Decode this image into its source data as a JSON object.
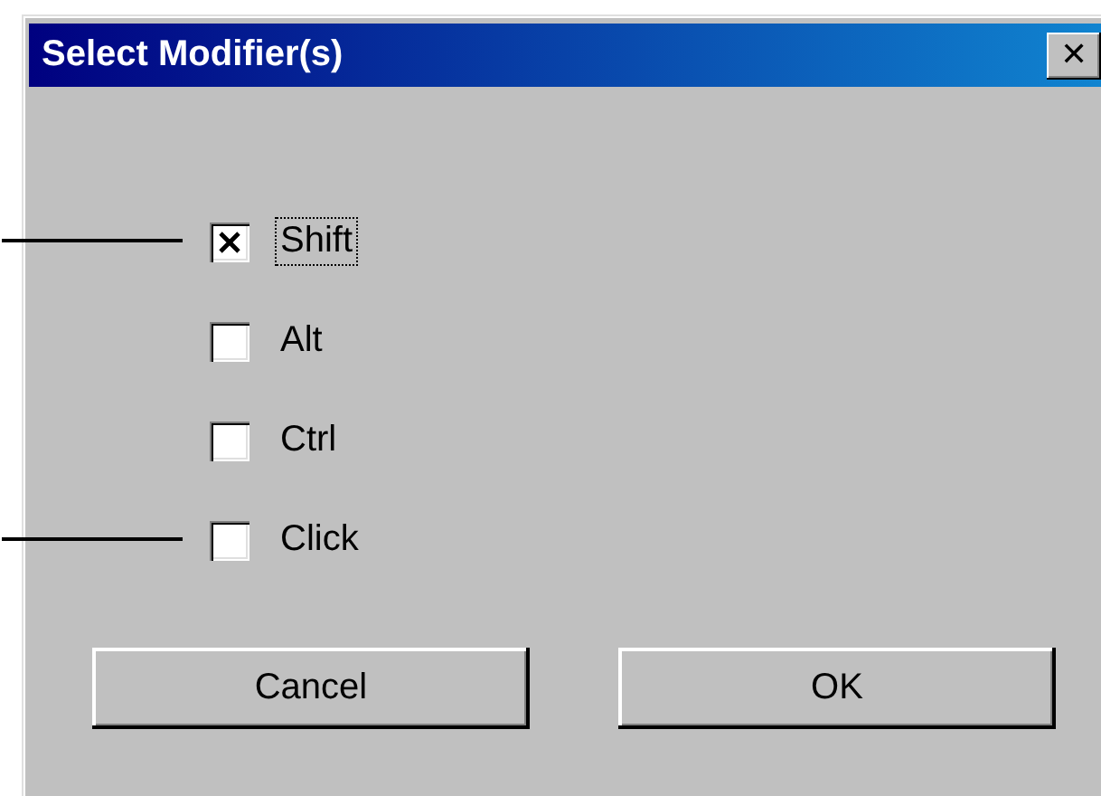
{
  "window": {
    "title": "Select Modifier(s)",
    "close": "✕"
  },
  "checkboxes": [
    {
      "label": "Shift",
      "checked": true,
      "focused": true,
      "callout": true
    },
    {
      "label": "Alt",
      "checked": false,
      "focused": false,
      "callout": false
    },
    {
      "label": "Ctrl",
      "checked": false,
      "focused": false,
      "callout": false
    },
    {
      "label": "Click",
      "checked": false,
      "focused": false,
      "callout": true
    }
  ],
  "buttons": [
    "Cancel",
    "OK"
  ]
}
